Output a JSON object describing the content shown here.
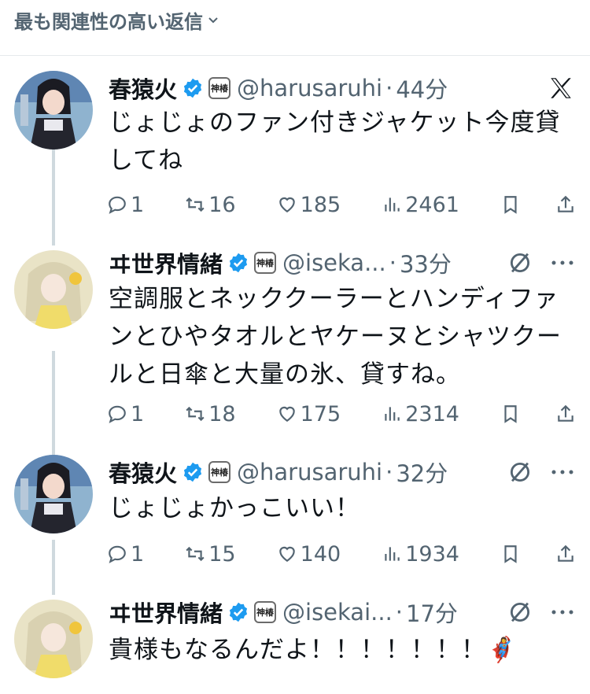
{
  "header": {
    "sort_label": "最も関連性の高い返信"
  },
  "tweets": [
    {
      "name": "春猿火",
      "handle": "@harusaruhi",
      "time": "44分",
      "text": "じょじょのファン付きジャケット今度貸してね",
      "replies": "1",
      "retweets": "16",
      "likes": "185",
      "views": "2461",
      "top_icon": "x-logo-icon"
    },
    {
      "name": "ヰ世界情緒",
      "handle": "@iseka...",
      "time": "33分",
      "text": "空調服とネッククーラーとハンディファンとひやタオルとヤケーヌとシャツクールと日傘と大量の氷、貸すね。",
      "replies": "1",
      "retweets": "18",
      "likes": "175",
      "views": "2314",
      "top_icon": "grok-icon"
    },
    {
      "name": "春猿火",
      "handle": "@harusaruhi",
      "time": "32分",
      "text": "じょじょかっこいい！",
      "replies": "1",
      "retweets": "15",
      "likes": "140",
      "views": "1934",
      "top_icon": "grok-icon"
    },
    {
      "name": "ヰ世界情緒",
      "handle": "@isekai...",
      "time": "17分",
      "text": "貴様もなるんだよ！！！！！！！🦸‍♀️",
      "top_icon": "grok-icon"
    }
  ],
  "affiliate_badge": "神椿",
  "colors": {
    "verified": "#1d9bf0",
    "muted": "#536471",
    "thread_line": "#cfd9de"
  }
}
